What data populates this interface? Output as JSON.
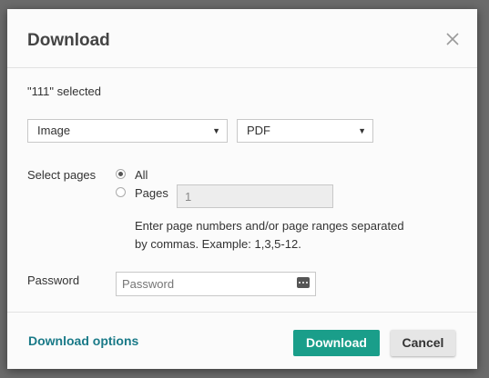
{
  "dialog": {
    "title": "Download",
    "selected_text": "\"111\" selected"
  },
  "format": {
    "type_value": "Image",
    "output_value": "PDF"
  },
  "pages": {
    "label": "Select pages",
    "option_all": "All",
    "option_pages": "Pages",
    "pages_value": "1",
    "hint": "Enter page numbers and/or page ranges separated by commas. Example: 1,3,5-12."
  },
  "password": {
    "label": "Password",
    "placeholder": "Password"
  },
  "footer": {
    "options_link": "Download options",
    "download_button": "Download",
    "cancel_button": "Cancel"
  },
  "colors": {
    "accent": "#1a9e8a",
    "link": "#1a7a88"
  },
  "icons": {
    "close": "close-icon",
    "caret": "caret-down-icon",
    "password_toggle": "password-dots-icon"
  }
}
